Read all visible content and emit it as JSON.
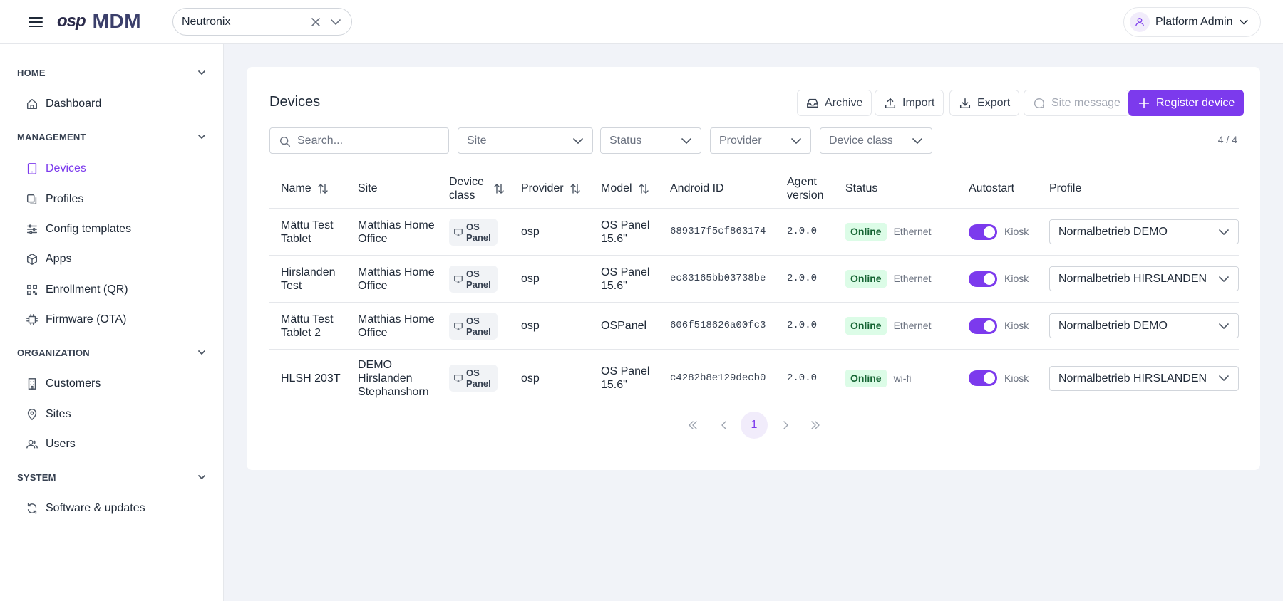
{
  "header": {
    "logo_osp": "osp",
    "logo_mdm": "MDM",
    "tenant": "Neutronix",
    "user": "Platform Admin"
  },
  "sidebar": {
    "home": {
      "title": "HOME",
      "items": [
        "Dashboard"
      ]
    },
    "management": {
      "title": "MANAGEMENT",
      "items": [
        "Devices",
        "Profiles",
        "Config templates",
        "Apps",
        "Enrollment (QR)",
        "Firmware (OTA)"
      ]
    },
    "organization": {
      "title": "ORGANIZATION",
      "items": [
        "Customers",
        "Sites",
        "Users"
      ]
    },
    "system": {
      "title": "SYSTEM",
      "items": [
        "Software & updates"
      ]
    }
  },
  "main": {
    "title": "Devices",
    "toolbar": {
      "archive": "Archive",
      "import": "Import",
      "export": "Export",
      "site_message": "Site message",
      "register": "Register device"
    },
    "filters": {
      "search_placeholder": "Search...",
      "site": "Site",
      "status": "Status",
      "provider": "Provider",
      "device_class": "Device class"
    },
    "count": "4 / 4",
    "columns": {
      "name": "Name",
      "site": "Site",
      "device_class": "Device class",
      "provider": "Provider",
      "model": "Model",
      "android_id": "Android ID",
      "agent_version": "Agent version",
      "status": "Status",
      "autostart": "Autostart",
      "profile": "Profile"
    },
    "rows": [
      {
        "name": "Mättu Test Tablet",
        "site": "Matthias Home Office",
        "device_class": "OS Panel",
        "provider": "osp",
        "model": "OS Panel 15.6\"",
        "android_id": "689317f5cf863174",
        "agent_version": "2.0.0",
        "status": "Online",
        "connection": "Ethernet",
        "autostart_mode": "Kiosk",
        "profile": "Normalbetrieb DEMO"
      },
      {
        "name": "Hirslanden Test",
        "site": "Matthias Home Office",
        "device_class": "OS Panel",
        "provider": "osp",
        "model": "OS Panel 15.6\"",
        "android_id": "ec83165bb03738be",
        "agent_version": "2.0.0",
        "status": "Online",
        "connection": "Ethernet",
        "autostart_mode": "Kiosk",
        "profile": "Normalbetrieb HIRSLANDEN"
      },
      {
        "name": "Mättu Test Tablet 2",
        "site": "Matthias Home Office",
        "device_class": "OS Panel",
        "provider": "osp",
        "model": "OSPanel",
        "android_id": "606f518626a00fc3",
        "agent_version": "2.0.0",
        "status": "Online",
        "connection": "Ethernet",
        "autostart_mode": "Kiosk",
        "profile": "Normalbetrieb DEMO"
      },
      {
        "name": "HLSH 203T",
        "site": "DEMO Hirslanden Stephanshorn",
        "device_class": "OS Panel",
        "provider": "osp",
        "model": "OS Panel 15.6\"",
        "android_id": "c4282b8e129decb0",
        "agent_version": "2.0.0",
        "status": "Online",
        "connection": "wi-fi",
        "autostart_mode": "Kiosk",
        "profile": "Normalbetrieb HIRSLANDEN"
      }
    ],
    "pagination": {
      "current_page": "1"
    }
  }
}
